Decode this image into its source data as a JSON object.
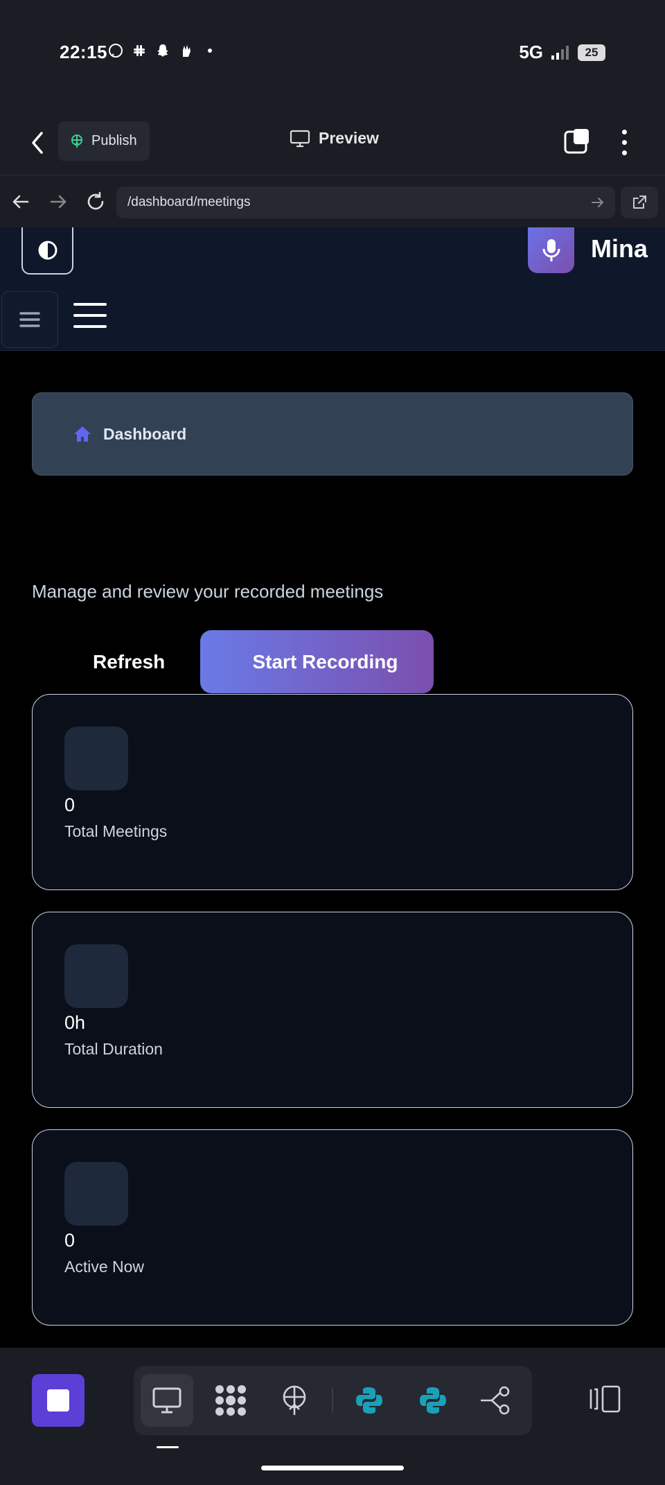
{
  "status_bar": {
    "time": "22:15",
    "notification_icons": [
      "whatsapp-icon",
      "slack-icon",
      "snapchat-icon",
      "hand-icon",
      "dot-icon"
    ],
    "network": "5G",
    "battery": "25"
  },
  "app_toolbar": {
    "publish_label": "Publish",
    "preview_label": "Preview"
  },
  "url_bar": {
    "url": "/dashboard/meetings"
  },
  "header": {
    "brand_name": "Mina"
  },
  "breadcrumb": {
    "label": "Dashboard"
  },
  "main": {
    "subtitle": "Manage and review your recorded meetings",
    "refresh_label": "Refresh",
    "start_recording_label": "Start Recording",
    "stats": [
      {
        "value": "0",
        "label": "Total Meetings"
      },
      {
        "value": "0h",
        "label": "Total Duration"
      },
      {
        "value": "0",
        "label": "Active Now"
      }
    ]
  },
  "dock": {
    "items": [
      "desktop-icon",
      "apps-icon",
      "publish-icon",
      "python-icon",
      "python-icon",
      "share-icon"
    ]
  },
  "colors": {
    "accent_purple": "#5b3fd6",
    "record_gradient_start": "#6a7ae6",
    "record_gradient_end": "#7b4fae",
    "header_bg": "#0f172a",
    "python_teal": "#1aa0b8"
  }
}
